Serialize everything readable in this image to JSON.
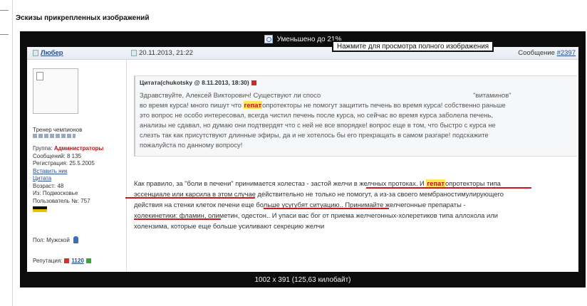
{
  "page": {
    "section_title": "Эскизы прикрепленных изображений"
  },
  "viewer": {
    "reduced_label": "Уменьшено до 21%",
    "image_info": "1002 x 391 (125,63 килобайт)",
    "tooltip": "Нажмите для просмотра полного изображения"
  },
  "post": {
    "username": "Любер",
    "date": "20.11.2013, 21:22",
    "message_label": "Сообщение",
    "message_number": "#2397"
  },
  "profile": {
    "rank": "Тренер чемпионов",
    "group_label": "Группа:",
    "group_value": "Администраторы",
    "messages": "Сообщений: 8 135",
    "registered": "Регистрация: 25.5.2005",
    "insert_nick": "Вставить ник",
    "quote_link": "Цитата",
    "age": "Возраст: 48",
    "from": "Из: Подмосковье",
    "user_no": "Пользователь №: 757",
    "gender": "Пол: Мужской",
    "rep_label": "Репутация:",
    "rep_value": "1120"
  },
  "quote": {
    "header": "Цитата(chukotsky @ 8.11.2013, 18:30)",
    "line1a": "Здравствуйте, Алексей Викторович! Существуют ли спосо",
    "line1b": "\"витаминов\"",
    "line2a": "во время курса! много пишут что ",
    "highlight": "гепат",
    "line2b": "опротекторы не помогут защитить печень во время курса! собственно раньше",
    "line3": "это вопрос не особо интересовал, всегда чистил печень после курса, но сейчас во время курса заболела печень,",
    "line4": "анализы не сдавал, но думаю они подтвердят что с ней не все впорядке! вопрос еще в том, что быстро с курса не",
    "line5": "слезть так как присутствуют длинные эфиры, да и не хотелось бы его прекращать в самом разгаре! подскажите",
    "line6": "пожалуйста по данному вопросу!"
  },
  "reply": {
    "l1a": "Как правило, за \"боли в печени\" принимается холестаз - застой желчи в желчных протоках. И ",
    "l1hl": "гепат",
    "l1b": "опротекторы типа",
    "l2": "эссенциале или карсила в этом случае действительно не только не помогут, а из-за своего мембраностимулирующего",
    "l3": "действия на стенки клеток печени еще больше усугубят ситуацию.. Принимайте желчегонные препараты -",
    "l4": "холекинетики: фламин, олиметин, одестон.. И упаси вас бог от приема желчегонных-холеретиков типа аллохола или",
    "l5": "холензима, которые еще больше усиливают секрецию желчи"
  },
  "colors": {
    "highlight_bg": "#ffe75a",
    "highlight_text": "#c01010",
    "underline": "#d01818",
    "link": "#2a4f8c"
  }
}
